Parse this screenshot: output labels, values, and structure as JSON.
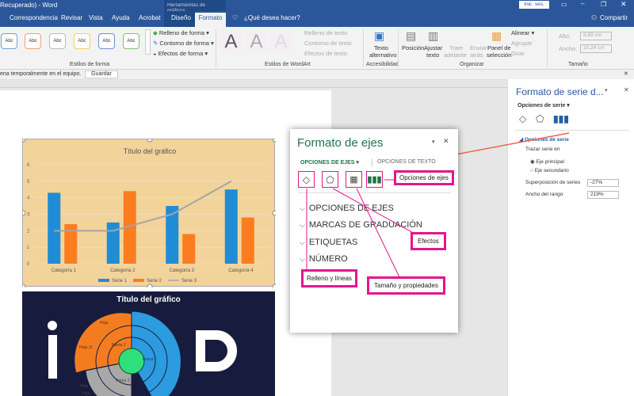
{
  "window": {
    "title": "Recuperado)  -  Word",
    "context_tab_group": "Herramientas de gráficos",
    "sign_in": "Inic. ses.",
    "share": "Compartir"
  },
  "tabs": [
    {
      "label": "Correspondencia"
    },
    {
      "label": "Revisar"
    },
    {
      "label": "Vista"
    },
    {
      "label": "Ayuda"
    },
    {
      "label": "Acrobat"
    },
    {
      "label": "Diseño"
    },
    {
      "label": "Formato",
      "active": true
    }
  ],
  "tell_me": "¿Qué desea hacer?",
  "ribbon": {
    "shape_styles": {
      "label": "Estilos de forma",
      "thumbs": [
        "Abc",
        "Abc",
        "Abc",
        "Abc",
        "Abc",
        "Abc"
      ],
      "fill": "Relleno de forma",
      "outline": "Contorno de forma",
      "effects": "Efectos de forma"
    },
    "wordart": {
      "label": "Estilos de WordArt",
      "letter": "A",
      "text_fill": "Relleno de texto",
      "text_outline": "Contorno de texto",
      "text_effects": "Efectos de texto"
    },
    "accessibility": {
      "label": "Accesibilidad",
      "alt_text_1": "Texto",
      "alt_text_2": "alternativo"
    },
    "arrange": {
      "label": "Organizar",
      "position": "Posición",
      "wrap_1": "Ajustar",
      "wrap_2": "texto",
      "forward_1": "Traer",
      "forward_2": "adelante",
      "back_1": "Enviar",
      "back_2": "atrás",
      "panel_1": "Panel de",
      "panel_2": "selección",
      "align": "Alinear",
      "group": "Agrupar",
      "rotate": "Girar"
    },
    "size": {
      "label": "Tamaño",
      "height_label": "Alto:",
      "height": "8,89 cm",
      "width_label": "Ancho:",
      "width": "15,24 cm"
    }
  },
  "message_bar": {
    "text": "ena temporalmente en el equipo.",
    "save": "Guardar"
  },
  "chart_data": [
    {
      "type": "bar",
      "title": "Título del gráfico",
      "categories": [
        "Categoría 1",
        "Categoría 2",
        "Categoría 3",
        "Categoría 4"
      ],
      "series": [
        {
          "name": "Serie 1",
          "type": "bar",
          "values": [
            4.3,
            2.5,
            3.5,
            4.5
          ],
          "color": "#1f8dd6"
        },
        {
          "name": "Serie 2",
          "type": "bar",
          "values": [
            2.4,
            4.4,
            1.8,
            2.8
          ],
          "color": "#fb7d1f"
        },
        {
          "name": "Serie 3",
          "type": "line",
          "values": [
            2,
            2,
            3,
            5
          ],
          "color": "#a5a5a5"
        }
      ],
      "yticks": [
        "0",
        "1",
        "2",
        "3",
        "4",
        "5",
        "6"
      ],
      "ylim": [
        0,
        6
      ],
      "legend": "bottom"
    },
    {
      "type": "sunburst",
      "title": "Título del gráfico",
      "labels": [
        "Rama 1",
        "Rama 2",
        "Rama 3",
        "Hoja 11",
        "Hoja",
        "Hoja",
        "Hoja"
      ],
      "background_logo": "iP P"
    }
  ],
  "series_pane": {
    "title": "Formato de serie d...",
    "options_dropdown": "Opciones de serie",
    "section": "Opciones de serie",
    "plot_on": "Trazar serie en",
    "primary": "Eje principal",
    "secondary": "Eje secundario",
    "overlap_label": "Superposición de series",
    "overlap": "-27%",
    "gap_label": "Ancho del rango",
    "gap": "219%"
  },
  "axis_pane": {
    "title": "Formato de ejes",
    "tab_axis": "OPCIONES DE EJES",
    "tab_text": "OPCIONES DE TEXTO",
    "sections": [
      "OPCIONES DE EJES",
      "MARCAS DE GRADUACIÓN",
      "ETIQUETAS",
      "NÚMERO"
    ],
    "callouts": {
      "axis_options": "Opciones de ejes",
      "effects": "Efectos",
      "fill_lines": "Relleno y líneas",
      "size_props": "Tamaño y propiedades"
    }
  },
  "colors": {
    "brand": "#2b579a",
    "accent_green": "#217346",
    "callout": "#e4168c"
  }
}
